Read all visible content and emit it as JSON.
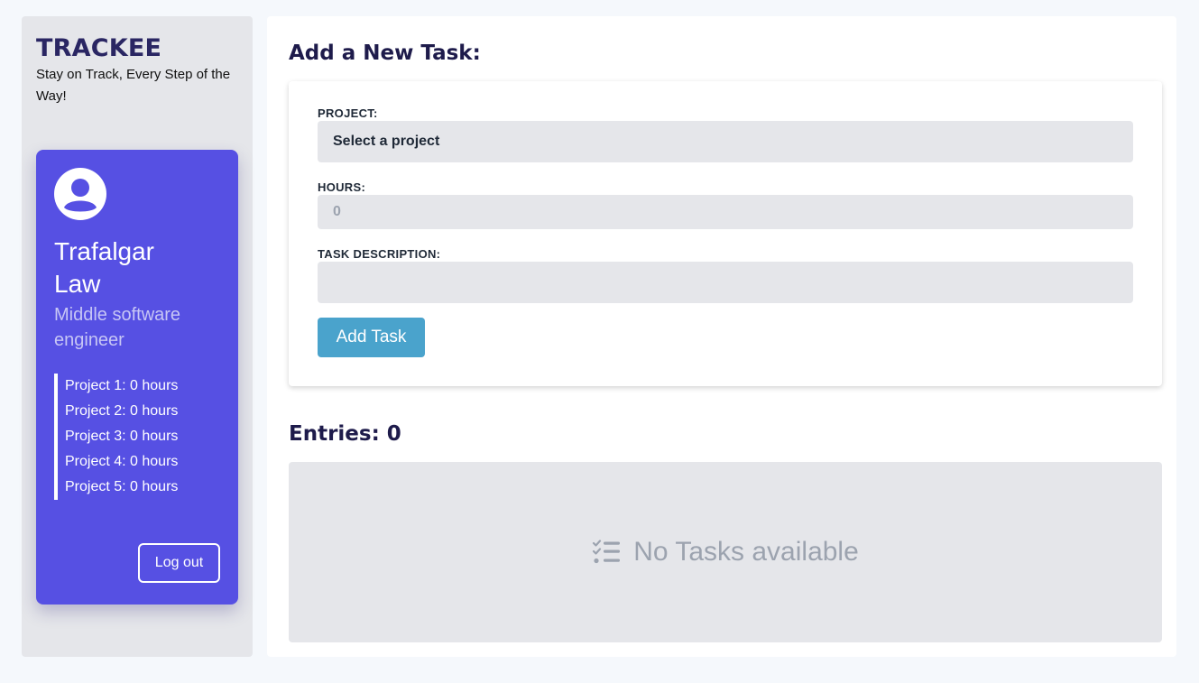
{
  "sidebar": {
    "brand": "TRACKEE",
    "tagline": "Stay on Track, Every Step of the Way!",
    "profile": {
      "avatar_icon": "user-avatar-icon",
      "name": "Trafalgar Law",
      "role": "Middle software engineer",
      "projects": [
        "Project 1: 0 hours",
        "Project 2: 0 hours",
        "Project 3: 0 hours",
        "Project 4: 0 hours",
        "Project 5: 0 hours"
      ],
      "logout_label": "Log out"
    }
  },
  "main": {
    "form_title": "Add a New Task:",
    "form": {
      "project_label": "PROJECT:",
      "project_value": "Select a project",
      "hours_label": "HOURS:",
      "hours_placeholder": "0",
      "description_label": "TASK DESCRIPTION:",
      "description_value": "",
      "submit_label": "Add Task"
    },
    "entries_title": "Entries: 0",
    "empty_state": {
      "icon": "checklist-icon",
      "text": "No Tasks available"
    }
  },
  "colors": {
    "accent": "#5650e3",
    "button": "#4aa3cc",
    "brand": "#2a2663",
    "panel": "#e5e6ea"
  }
}
